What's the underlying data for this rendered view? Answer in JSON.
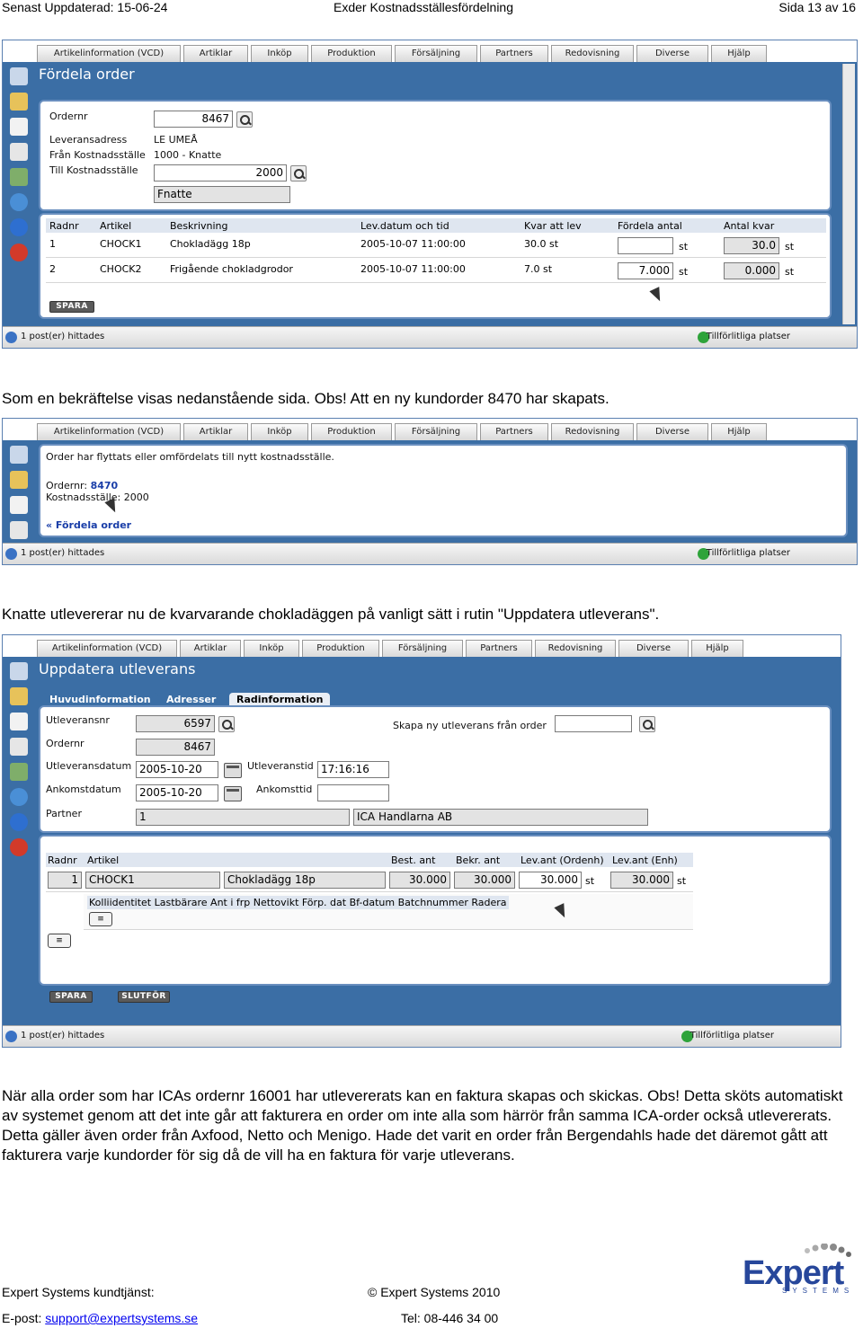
{
  "page_header": {
    "left": "Senast Uppdaterad: 15-06-24",
    "center": "Exder Kostnadsställesfördelning",
    "right": "Sida 13 av 16"
  },
  "tabs": [
    "Artikelinformation (VCD)",
    "Artiklar",
    "Inköp",
    "Produktion",
    "Försäljning",
    "Partners",
    "Redovisning",
    "Diverse",
    "Hjälp"
  ],
  "status": {
    "left": "1 post(er) hittades",
    "right": "Tillförlitliga platser"
  },
  "shot1": {
    "title": "Fördela order",
    "form": {
      "ordernr_label": "Ordernr",
      "ordernr_value": "8467",
      "address_label": "Leveransadress",
      "address_value": "LE UMEÅ",
      "from_label": "Från Kostnadsställe",
      "from_value": "1000 - Knatte",
      "to_label": "Till Kostnadsställe",
      "to_value": "2000",
      "to_name": "Fnatte"
    },
    "table": {
      "headers": [
        "Radnr",
        "Artikel",
        "Beskrivning",
        "Lev.datum och tid",
        "Kvar att lev",
        "Fördela antal",
        "Antal kvar"
      ],
      "rows": [
        {
          "radnr": "1",
          "artikel": "CHOCK1",
          "beskrivning": "Chokladägg 18p",
          "lev": "2005-10-07 11:00:00",
          "kvar": "30.0 st",
          "fordela": "",
          "fordela_unit": "st",
          "antal": "30.0",
          "antal_unit": "st"
        },
        {
          "radnr": "2",
          "artikel": "CHOCK2",
          "beskrivning": "Frigående chokladgrodor",
          "lev": "2005-10-07 11:00:00",
          "kvar": "7.0 st",
          "fordela": "7.000",
          "fordela_unit": "st",
          "antal": "0.000",
          "antal_unit": "st"
        }
      ]
    },
    "save_label": "SPARA"
  },
  "para1": "Som en bekräftelse visas nedanstående sida. Obs! Att en ny kundorder 8470 har skapats.",
  "shot2": {
    "message": "Order har flyttats eller omfördelats till nytt kostnadsställe.",
    "ordernr_label": "Ordernr:",
    "ordernr_value": "8470",
    "kst_label": "Kostnadsställe:",
    "kst_value": "2000",
    "back_link": "« Fördela order"
  },
  "para2": "Knatte utlevererar nu de kvarvarande chokladäggen på vanligt sätt i rutin \"Uppdatera utleverans\".",
  "shot3": {
    "title": "Uppdatera utleverans",
    "subtabs": [
      "Huvudinformation",
      "Adresser",
      "Radinformation"
    ],
    "form": {
      "utlev_label": "Utleveransnr",
      "utlev_value": "6597",
      "order_label": "Ordernr",
      "order_value": "8467",
      "datum_label": "Utleveransdatum",
      "datum_value": "2005-10-20",
      "tid_label": "Utleveranstid",
      "tid_value": "17:16:16",
      "ank_label": "Ankomstdatum",
      "ank_value": "2005-10-20",
      "anktid_label": "Ankomsttid",
      "anktid_value": "",
      "partner_label": "Partner",
      "partner_value": "1",
      "partner_name": "ICA Handlarna AB",
      "skapa_label": "Skapa ny utleverans från order",
      "skapa_value": ""
    },
    "table": {
      "headers": [
        "Radnr",
        "Artikel",
        "Best. ant",
        "Bekr. ant",
        "Lev.ant (Ordenh)",
        "Lev.ant (Enh)"
      ],
      "row": {
        "radnr": "1",
        "artikel": "CHOCK1",
        "beskrivning": "Chokladägg 18p",
        "best": "30.000",
        "bekr": "30.000",
        "levord": "30.000",
        "levord_unit": "st",
        "levenh": "30.000",
        "levenh_unit": "st"
      },
      "sub_headers": "Kolliidentitet Lastbärare Ant i frp Nettovikt Förp. dat Bf-datum Batchnummer Radera"
    },
    "save_label": "SPARA",
    "finish_label": "SLUTFÖR"
  },
  "para3": "När alla order som har ICAs ordernr 16001 har utlevererats kan en faktura skapas och skickas. Obs! Detta sköts automatiskt av systemet genom att det inte går att fakturera en order om inte alla som härrör från samma ICA-order också utlevererats. Detta gäller även order från Axfood, Netto och Menigo. Hade det varit en order från Bergendahls hade det däremot gått att fakturera varje kundorder för sig då de vill ha en faktura för varje utleverans.",
  "footer": {
    "left1": "Expert Systems kundtjänst:",
    "center1": "© Expert Systems 2010",
    "left2_label": "E-post: ",
    "email": "support@expertsystems.se",
    "center2": "Tel: 08-446 34 00",
    "logo_text": "Expert",
    "logo_sub": "SYSTEMS"
  }
}
